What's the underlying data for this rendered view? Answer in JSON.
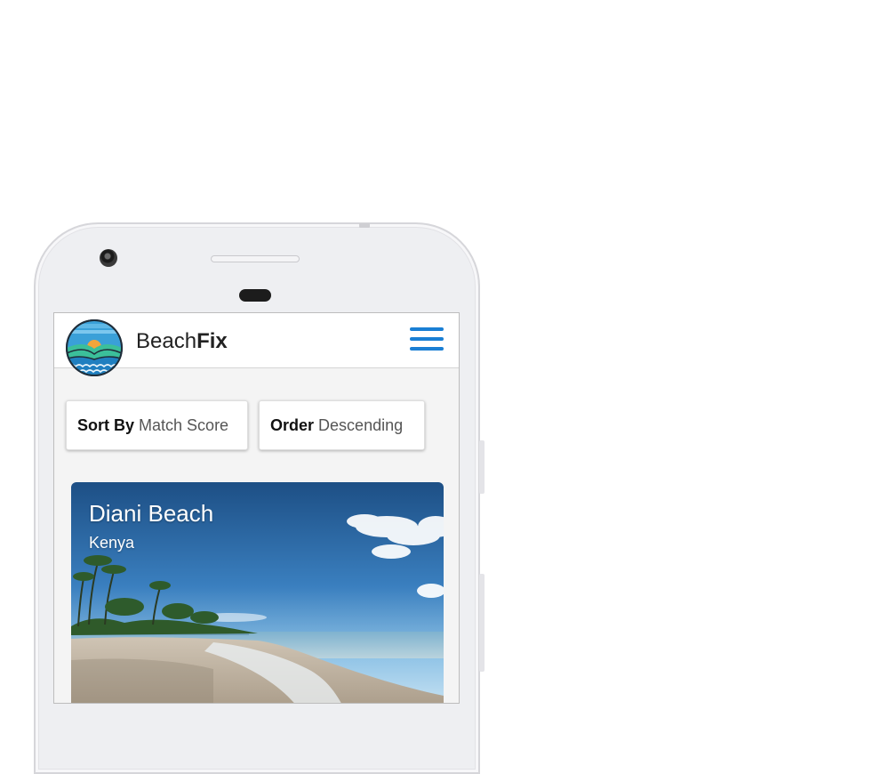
{
  "app": {
    "brand_regular": "Beach",
    "brand_bold": "Fix",
    "logo_icon": "beach-sunset-logo",
    "menu_icon": "hamburger-menu-icon",
    "accent_color": "#1a7fd4"
  },
  "controls": {
    "sort_key": "Sort By",
    "sort_value": "Match Score",
    "order_key": "Order",
    "order_value": "Descending"
  },
  "results": [
    {
      "name": "Diani Beach",
      "country": "Kenya"
    }
  ]
}
